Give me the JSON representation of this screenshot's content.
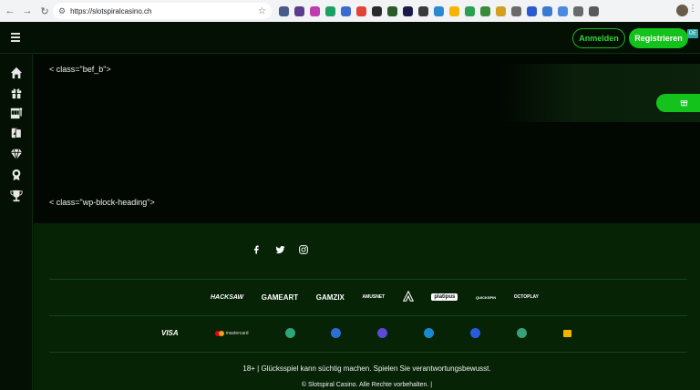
{
  "browser": {
    "url": "https://slotspiralcasino.ch",
    "extension_colors": [
      "#4a5a8a",
      "#5a3c8a",
      "#c03ab0",
      "#1aa062",
      "#3a6ad0",
      "#e0433a",
      "#2a2a2a",
      "#2a5a2a",
      "#1a1a4a",
      "#3a3a3a",
      "#2a8ad0",
      "#f5b400",
      "#2aa050",
      "#3a8a3a",
      "#d4a020",
      "#6a6a6a",
      "#2a5ad0",
      "#3a7ad0",
      "#4a8ae0",
      "#6a6a6a",
      "#5a5a5a"
    ],
    "corner_badge": "DE"
  },
  "header": {
    "login_label": "Anmelden",
    "register_label": "Registrieren"
  },
  "sidebar": {
    "items": [
      "home-icon",
      "gift-icon",
      "slot-machine-icon",
      "cards-icon",
      "diamond-icon",
      "medal-icon",
      "trophy-icon"
    ]
  },
  "main": {
    "raw_text_1": "< class=\"bef_b\">",
    "raw_text_2": "< class=\"wp-block-heading\">"
  },
  "footer": {
    "socials": [
      "facebook-icon",
      "twitter-icon",
      "instagram-icon"
    ],
    "providers": [
      "HACKSAW",
      "GAMEART",
      "GAMZIX",
      "AMUSNET",
      "platipus",
      "QUICKSPIN",
      "OCTOPLAY"
    ],
    "payments": [
      "VISA",
      "mastercard"
    ],
    "responsible_text": "18+ | Glücksspiel kann süchtig machen. Spielen Sie verantwortungsbewusst.",
    "copyright_text": "© Slotspiral Casino. Alle Rechte vorbehalten. |",
    "colors": {
      "accent": "#13c21b",
      "footer_bg": "#062306",
      "page_bg": "#041004"
    }
  }
}
